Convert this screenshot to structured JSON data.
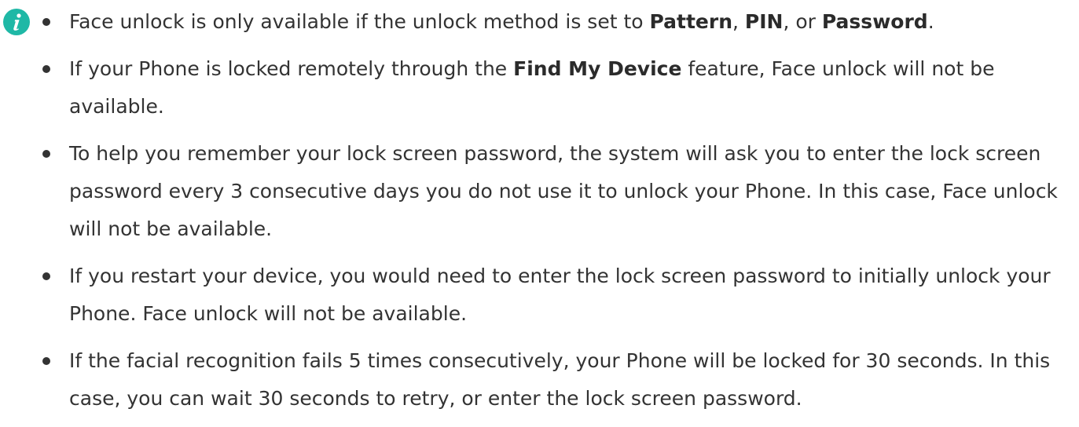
{
  "icon": {
    "name": "info-icon",
    "color": "#1fb8a6"
  },
  "notes": [
    {
      "parts": [
        "Face unlock is only available if the unlock method is set to ",
        "Pattern",
        ", ",
        "PIN",
        ", or ",
        "Password",
        "."
      ]
    },
    {
      "parts": [
        "If your Phone is locked remotely through the ",
        "Find My Device",
        " feature, Face unlock will not be available."
      ]
    },
    {
      "text": "To help you remember your lock screen password, the system will ask you to enter the lock screen password every 3 consecutive days you do not use it to unlock your Phone. In this case, Face unlock will not be available."
    },
    {
      "text": "If you restart your device, you would need to enter the lock screen password to initially unlock your Phone. Face unlock will not be available."
    },
    {
      "text": "If the facial recognition fails 5 times consecutively, your Phone will be locked for 30 seconds. In this case, you can wait 30 seconds to retry, or enter the lock screen password."
    }
  ]
}
